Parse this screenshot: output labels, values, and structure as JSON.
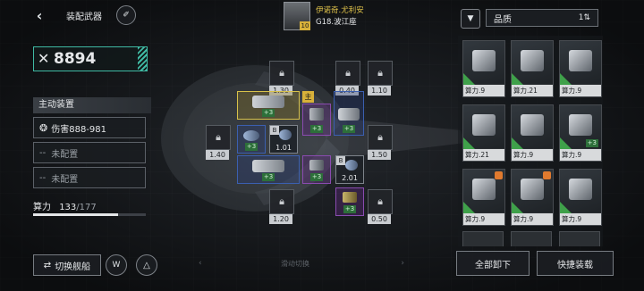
{
  "header": {
    "title": "装配武器",
    "commander_name": "伊诺奇.尤利安",
    "commander_level": "10",
    "ship_name": "G18.波江座"
  },
  "left": {
    "combat_power": "8894",
    "active_section_title": "主动装置",
    "active_device": "伤害888-981",
    "empty_slot_label": "未配置",
    "compute_label": "算力",
    "compute_used": "133",
    "compute_total": "/177",
    "compute_fraction": 0.751,
    "switch_ship_label": "切换舰船"
  },
  "grid": {
    "locks": [
      "1.30",
      "0.40",
      "1.10",
      "1.40",
      "1.50",
      "1.20",
      "0.50"
    ],
    "main_tag": "主",
    "slot_level": "B",
    "slot_values": [
      "1.01",
      "2.01"
    ],
    "plus_label": "+3"
  },
  "bottom": {
    "swipe_hint": "滑动切换",
    "unequip_all": "全部卸下",
    "quick_equip": "快捷装载"
  },
  "filter": {
    "sort_label": "品质"
  },
  "inventory": {
    "items": [
      {
        "label": "算力.9",
        "plus": "",
        "locked": false
      },
      {
        "label": "算力.21",
        "plus": "",
        "locked": false
      },
      {
        "label": "算力.9",
        "plus": "",
        "locked": false
      },
      {
        "label": "算力.21",
        "plus": "",
        "locked": false
      },
      {
        "label": "算力.9",
        "plus": "",
        "locked": false
      },
      {
        "label": "算力.9",
        "plus": "+3",
        "locked": false
      },
      {
        "label": "算力.9",
        "plus": "",
        "locked": true
      },
      {
        "label": "算力.9",
        "plus": "",
        "locked": true
      },
      {
        "label": "算力.9",
        "plus": "",
        "locked": false
      }
    ]
  },
  "colors": {
    "accent_teal": "#3fb9a3",
    "quality_green": "#3fa14a",
    "slot_yellow": "#d8c24a",
    "slot_blue": "#3b5fb0",
    "slot_purple": "#8a4bb0"
  }
}
